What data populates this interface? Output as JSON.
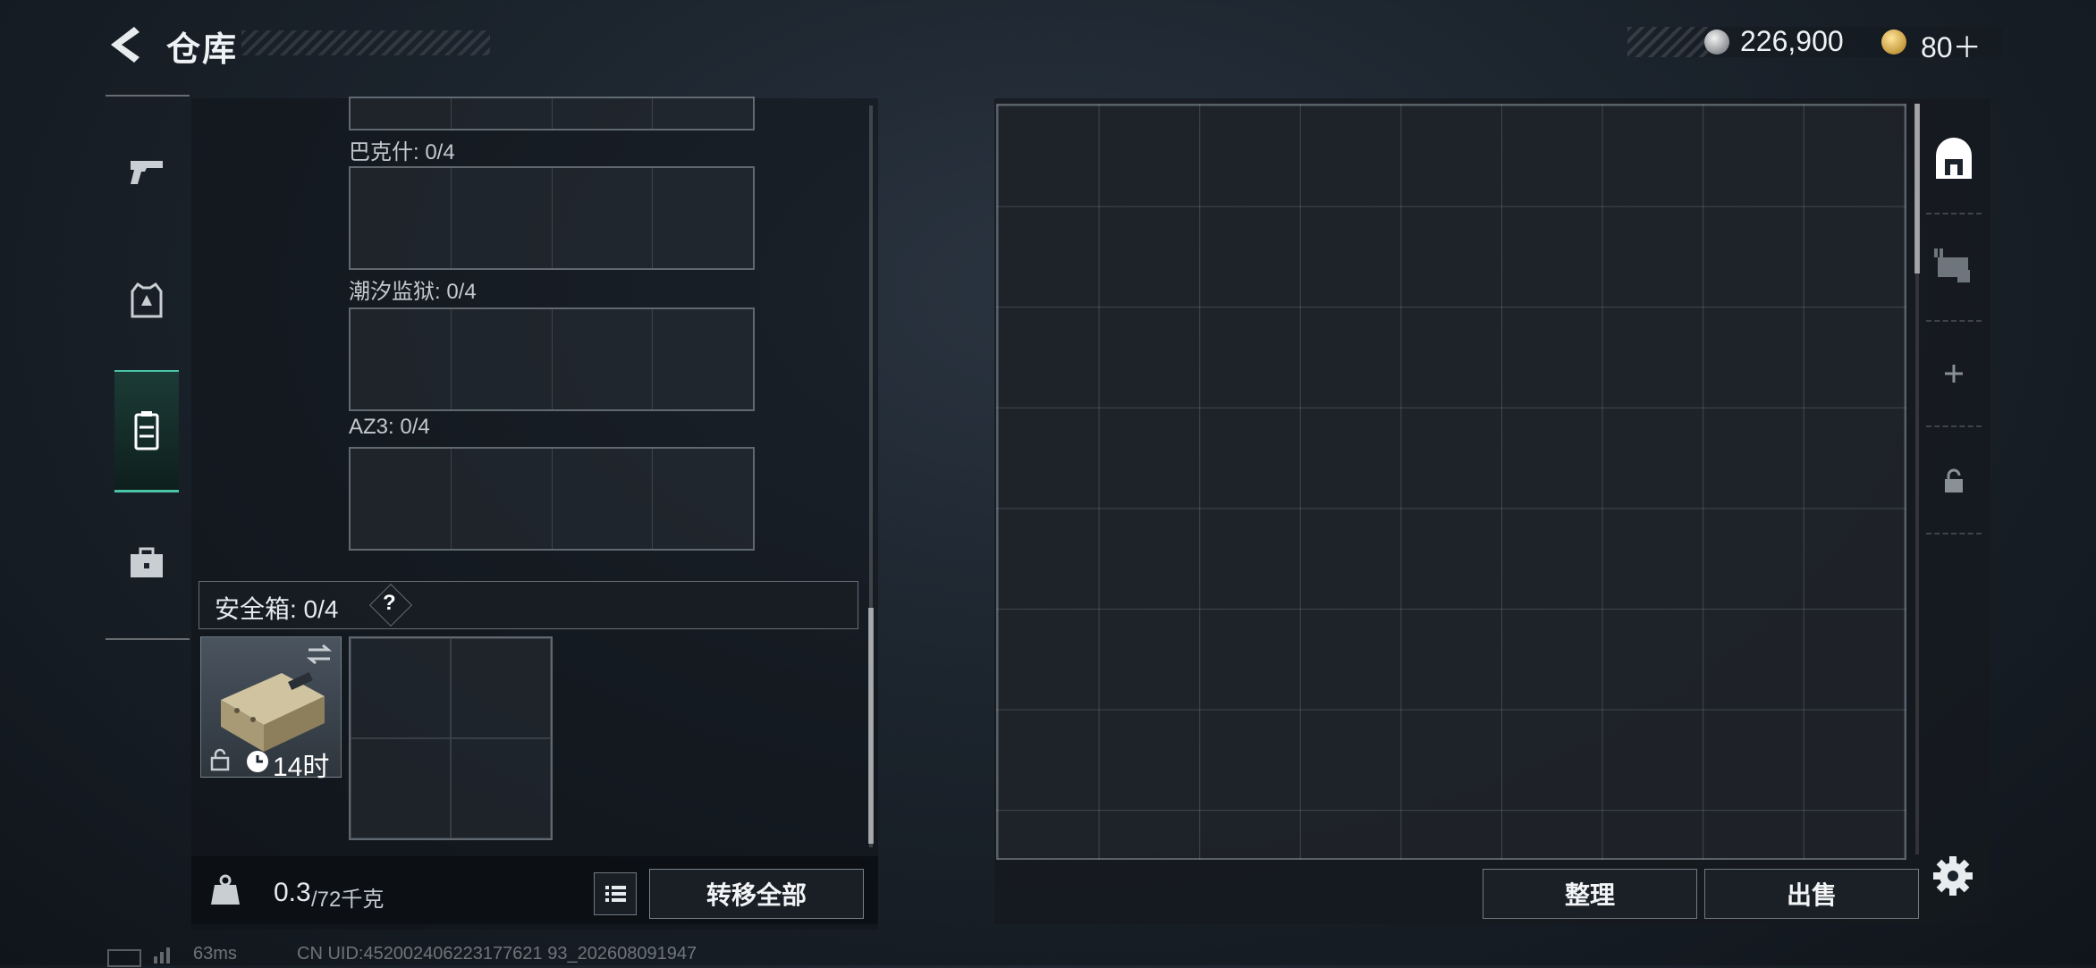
{
  "header": {
    "title": "仓库",
    "coin_amount": "226,900",
    "ticket_amount": "80＋"
  },
  "nav": {
    "tabs": [
      {
        "name": "pistol-icon",
        "active": false
      },
      {
        "name": "vest-icon",
        "active": false
      },
      {
        "name": "container-icon",
        "active": true
      },
      {
        "name": "briefcase-icon",
        "active": false
      }
    ],
    "accent": "#49c4a7"
  },
  "inventory": {
    "maps": [
      {
        "label": "巴克什: 0/4"
      },
      {
        "label": "潮汐监狱: 0/4"
      },
      {
        "label": "AZ3: 0/4"
      }
    ],
    "safebox": {
      "label": "安全箱:  0/4",
      "help": "?",
      "timer": "14时"
    },
    "weight": {
      "current": "0.3",
      "max": "/72千克"
    },
    "transfer_all_label": "转移全部"
  },
  "storage": {
    "columns": 9,
    "sort_label": "整理",
    "sell_label": "出售",
    "side_tabs": [
      "storage-main-icon",
      "expansion-card-icon",
      "add-icon",
      "lock-icon"
    ]
  },
  "status": {
    "ping": "63ms",
    "uid": "CN UID:452002406223177621 93_202608091947"
  }
}
